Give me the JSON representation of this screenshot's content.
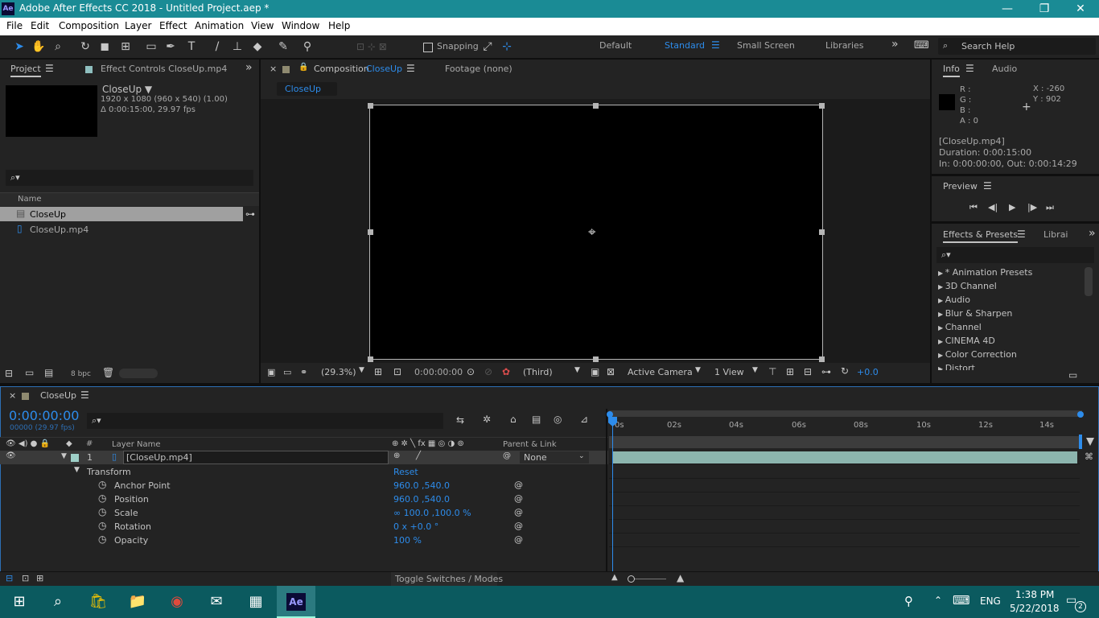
{
  "window": {
    "title": "Adobe After Effects CC 2018 - Untitled Project.aep *",
    "logo": "Ae",
    "minimize": "—",
    "restore": "❐",
    "close": "✕"
  },
  "menu": [
    "File",
    "Edit",
    "Composition",
    "Layer",
    "Effect",
    "Animation",
    "View",
    "Window",
    "Help"
  ],
  "toolbar": {
    "snapping": "Snapping",
    "workspaces": [
      "Default",
      "Standard",
      "Small Screen",
      "Libraries"
    ],
    "active_workspace": "Standard",
    "search_help": "Search Help",
    "more": "»"
  },
  "project": {
    "tab_project": "Project",
    "tab_effect_controls": "Effect Controls CloseUp.mp4",
    "comp_name": "CloseUp ▼",
    "comp_res": "1920 x 1080  (960 x 540) (1.00)",
    "comp_dur": "Δ 0:00:15:00, 29.97 fps",
    "search_glyph": "⌕▾",
    "col_name": "Name",
    "items": [
      "CloseUp",
      "CloseUp.mp4"
    ],
    "bpc": "8 bpc"
  },
  "composition": {
    "close": "×",
    "tab_label": "Composition",
    "tab_name": "CloseUp",
    "footage_tab": "Footage  (none)",
    "breadcrumb": "CloseUp",
    "zoom": "(29.3%)",
    "timecode": "0:00:00:00",
    "resolution": "(Third)",
    "camera": "Active Camera",
    "views": "1 View",
    "exposure": "+0.0"
  },
  "info": {
    "tab_info": "Info",
    "tab_audio": "Audio",
    "r": "R :",
    "g": "G :",
    "b": "B :",
    "a": "A :  0",
    "x": "X : -260",
    "y": "Y :  902",
    "file": "[CloseUp.mp4]",
    "duration": "Duration: 0:00:15:00",
    "inout": "In: 0:00:00:00, Out: 0:00:14:29"
  },
  "preview": {
    "title": "Preview",
    "controls": [
      "⏮",
      "◀|",
      "▶",
      "|▶",
      "⏭"
    ]
  },
  "effects": {
    "tab": "Effects & Presets",
    "tab2": "Librai",
    "search_glyph": "⌕▾",
    "items": [
      "* Animation Presets",
      "3D Channel",
      "Audio",
      "Blur & Sharpen",
      "Channel",
      "CINEMA 4D",
      "Color Correction",
      "Distort"
    ]
  },
  "timeline": {
    "close": "×",
    "tab": "CloseUp",
    "timecode": "0:00:00:00",
    "frame_info": "00000 (29.97 fps)",
    "search_glyph": "⌕▾",
    "col_layer_name": "Layer Name",
    "col_hash": "#",
    "col_parent": "Parent & Link",
    "layer_num": "1",
    "layer_name": "[CloseUp.mp4]",
    "parent_value": "None",
    "transform": "Transform",
    "reset": "Reset",
    "props": [
      {
        "name": "Anchor Point",
        "value": "960.0 ,540.0"
      },
      {
        "name": "Position",
        "value": "960.0 ,540.0"
      },
      {
        "name": "Scale",
        "value": "∞ 100.0 ,100.0 %"
      },
      {
        "name": "Rotation",
        "value": "0 x +0.0 °"
      },
      {
        "name": "Opacity",
        "value": "100 %"
      }
    ],
    "ruler": [
      "0s",
      "02s",
      "04s",
      "06s",
      "08s",
      "10s",
      "12s",
      "14s"
    ],
    "toggle": "Toggle Switches / Modes"
  },
  "taskbar": {
    "lang": "ENG",
    "time": "1:38 PM",
    "date": "5/22/2018",
    "notifications": "2"
  }
}
